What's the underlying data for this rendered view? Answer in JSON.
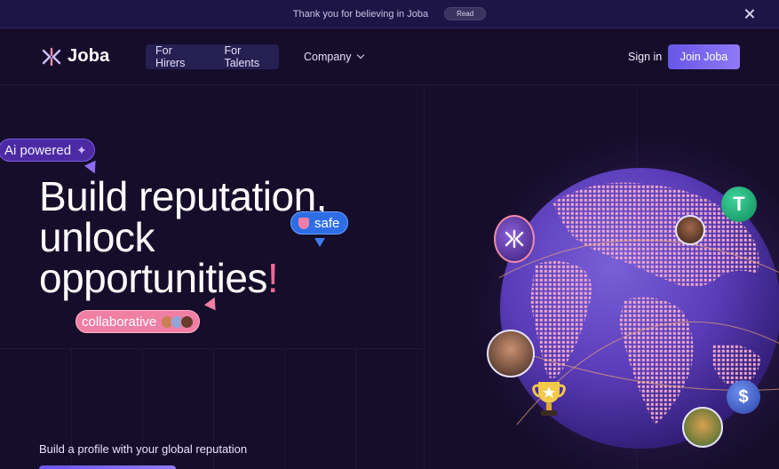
{
  "announcement": {
    "message": "Thank you for believing in Joba",
    "read_label": "Read"
  },
  "nav": {
    "logo_text": "Joba",
    "pill_items": [
      "For Hirers",
      "For Talents"
    ],
    "company_label": "Company",
    "signin_label": "Sign in",
    "join_label": "Join Joba"
  },
  "hero": {
    "ai_badge": "Ai powered",
    "headline_lines": [
      "Build reputation,",
      "unlock",
      "opportunities"
    ],
    "headline_excl": "!",
    "safe_badge": "safe",
    "collab_badge": "collaborative",
    "subline": "Build a profile with your global reputation"
  },
  "colors": {
    "background": "#150d2a",
    "accent_purple": "#6757e8",
    "accent_pink": "#f07fa4",
    "accent_blue": "#2e6de6"
  },
  "icons": [
    "joba-logo-icon",
    "close-icon",
    "chevron-down-icon",
    "sparkle-icon",
    "shield-icon",
    "tether-coin-icon",
    "dollar-coin-icon",
    "trophy-icon"
  ]
}
